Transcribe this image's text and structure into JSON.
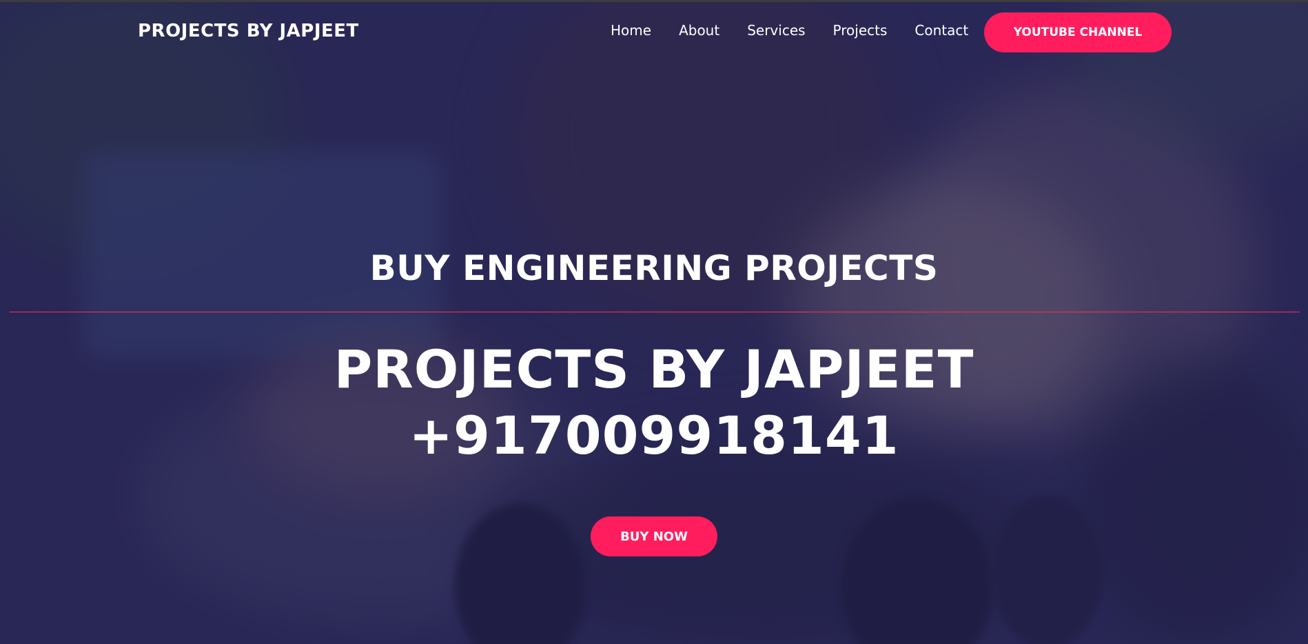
{
  "header": {
    "brand": "PROJECTS BY JAPJEET",
    "nav": [
      "Home",
      "About",
      "Services",
      "Projects",
      "Contact"
    ],
    "cta_label": "YOUTUBE CHANNEL"
  },
  "hero": {
    "subtitle": "BUY ENGINEERING PROJECTS",
    "title_line1": "PROJECTS BY JAPJEET",
    "title_line2": "+917009918141",
    "button_label": "BUY NOW"
  },
  "colors": {
    "accent": "#ff1d5e",
    "overlay": "#28245a",
    "text": "#ffffff"
  }
}
